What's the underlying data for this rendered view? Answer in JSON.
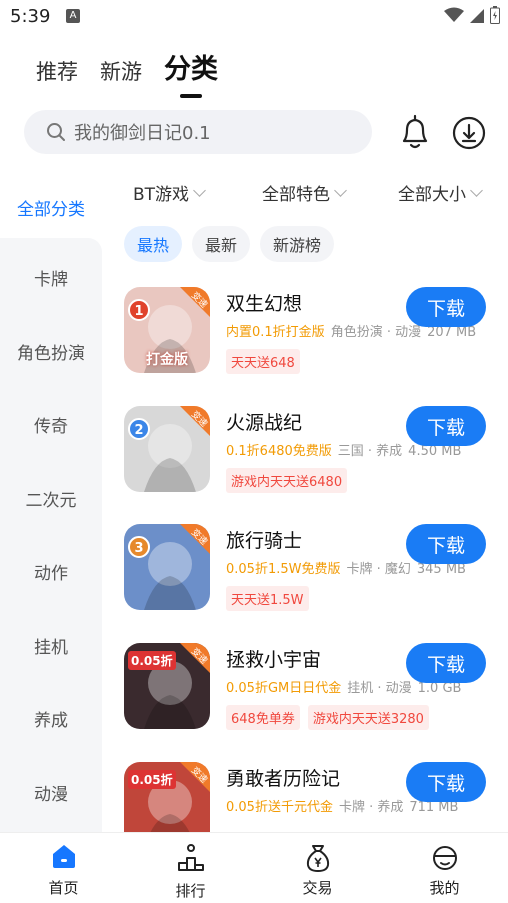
{
  "status": {
    "time": "5:39",
    "a_badge": "A"
  },
  "top_tabs": [
    "推荐",
    "新游",
    "分类"
  ],
  "search": {
    "placeholder": "我的御剑日记0.1"
  },
  "sidebar": {
    "active": "全部分类",
    "items": [
      "卡牌",
      "角色扮演",
      "传奇",
      "二次元",
      "动作",
      "挂机",
      "养成",
      "动漫"
    ]
  },
  "filters": [
    "BT游戏",
    "全部特色",
    "全部大小"
  ],
  "sort_tabs": [
    "最热",
    "最新",
    "新游榜"
  ],
  "download_label": "下载",
  "games": [
    {
      "name": "双生幻想",
      "promo": "内置0.1折打金版",
      "meta": "角色扮演 · 动漫",
      "size": "207 MB",
      "tags": [
        "天天送648"
      ],
      "rank": "1",
      "icon_bg": "#e9c7c0",
      "icon_text": "打金版"
    },
    {
      "name": "火源战纪",
      "promo": "0.1折6480免费版",
      "meta": "三国 · 养成",
      "size": "4.50 MB",
      "tags": [
        "游戏内天天送6480"
      ],
      "rank": "2",
      "icon_bg": "#d8d8d8",
      "icon_text": ""
    },
    {
      "name": "旅行骑士",
      "promo": "0.05折1.5W免费版",
      "meta": "卡牌 · 魔幻",
      "size": "345 MB",
      "tags": [
        "天天送1.5W"
      ],
      "rank": "3",
      "icon_bg": "#6c8fc9",
      "icon_text": ""
    },
    {
      "name": "拯救小宇宙",
      "promo": "0.05折GM日日代金",
      "meta": "挂机 · 动漫",
      "size": "1.0 GB",
      "tags": [
        "648免单券",
        "游戏内天天送3280"
      ],
      "rank": "",
      "icon_bg": "#3a2a2e",
      "icon_text": "0.05折"
    },
    {
      "name": "勇敢者历险记",
      "promo": "0.05折送千元代金",
      "meta": "卡牌 · 养成",
      "size": "711 MB",
      "tags": [],
      "rank": "",
      "icon_bg": "#c0463a",
      "icon_text": "0.05折"
    }
  ],
  "icon_badge": "变速",
  "bottom_nav": [
    "首页",
    "排行",
    "交易",
    "我的"
  ],
  "colors": {
    "accent": "#1677ff",
    "promo": "#f29b05",
    "tag": "#f0483e"
  }
}
